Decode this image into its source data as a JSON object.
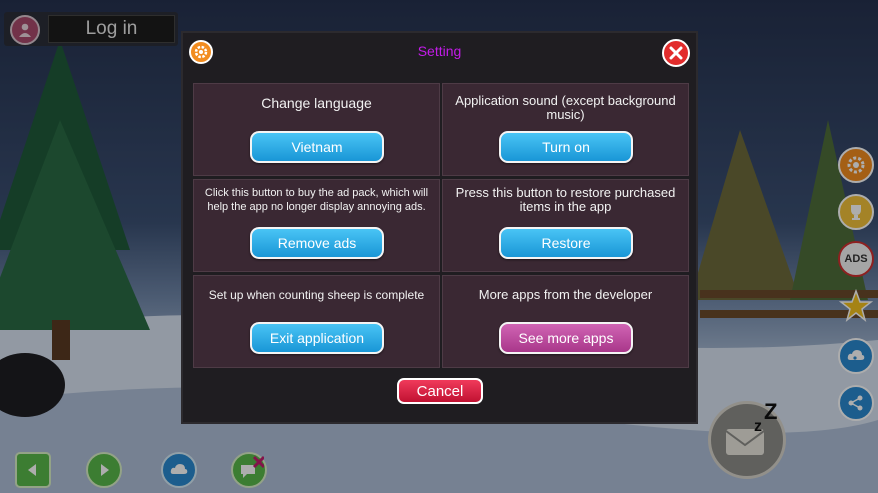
{
  "header": {
    "login_label": "Log in"
  },
  "dialog": {
    "title": "Setting",
    "cells": [
      {
        "description": "Change language",
        "button": "Vietnam"
      },
      {
        "description": "Application sound (except background music)",
        "button": "Turn on"
      },
      {
        "description": "Click this button to buy the ad pack, which will help the app no longer display annoying ads.",
        "button": "Remove ads"
      },
      {
        "description": "Press this button to restore purchased items in the app",
        "button": "Restore"
      },
      {
        "description": "Set up when counting sheep is complete",
        "button": "Exit application"
      },
      {
        "description": "More apps from the developer",
        "button": "See more apps"
      }
    ],
    "cancel": "Cancel"
  },
  "side_buttons": {
    "ads_label": "ADS"
  },
  "colors": {
    "title": "#c21ce8",
    "blue_button": "#1996d6",
    "pink_button": "#a9378a",
    "cancel_button": "#c11232"
  }
}
